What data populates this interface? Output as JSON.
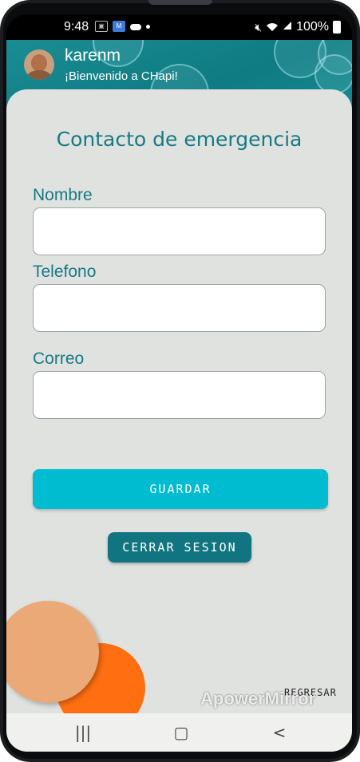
{
  "status_bar": {
    "time": "9:48",
    "battery": "100%",
    "icons": [
      "notification-icon",
      "app-icon",
      "cloud-icon",
      "dot-icon",
      "mute-icon",
      "wifi-icon",
      "signal-icon",
      "battery-icon"
    ]
  },
  "header": {
    "username": "karenm",
    "welcome": "¡Bienvenido a CHapi!"
  },
  "form": {
    "title": "Contacto de emergencia",
    "fields": [
      {
        "label": "Nombre",
        "value": ""
      },
      {
        "label": "Telefono",
        "value": ""
      },
      {
        "label": "Correo",
        "value": ""
      }
    ],
    "save_label": "GUARDAR",
    "logout_label": "CERRAR SESION",
    "back_label": "REGRESAR"
  },
  "watermark": "ApowerMirror",
  "nav": {
    "recents_glyph": "|||",
    "home_glyph": "▢",
    "back_glyph": "<"
  },
  "colors": {
    "accent_teal": "#167a84",
    "save_button": "#00bcd0",
    "logout_button": "#107580",
    "peach": "#eba978",
    "orange": "#ff6f12"
  }
}
